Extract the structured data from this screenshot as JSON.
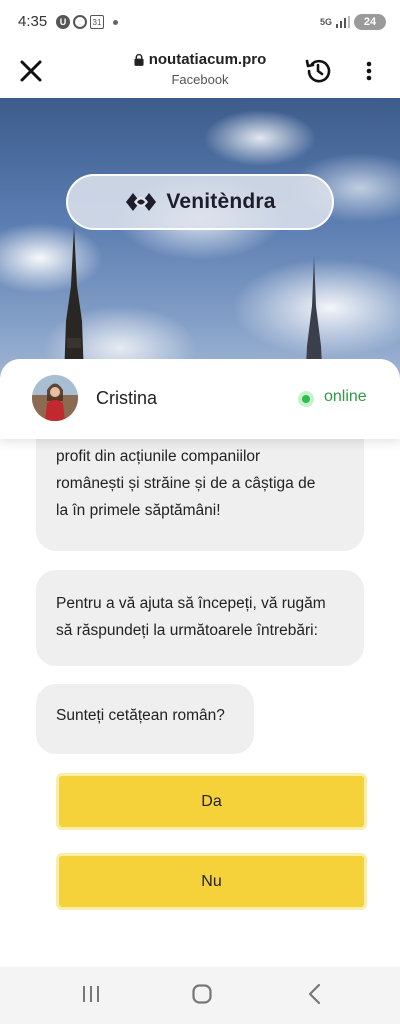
{
  "status_bar": {
    "time": "4:35",
    "badge_u": "U",
    "calendar_day": "31",
    "network": "5G",
    "battery": "24"
  },
  "browser": {
    "domain": "noutatiacum.pro",
    "subtitle": "Facebook",
    "icons": [
      "close-icon",
      "lock-icon",
      "history-icon",
      "more-vertical-icon"
    ]
  },
  "hero": {
    "brand_name": "Venitèndra",
    "icons": [
      "brand-logo-icon"
    ]
  },
  "chat": {
    "agent_name": "Cristina",
    "status": "online",
    "status_color": "#2bbf4a",
    "messages": [
      {
        "text_lines": [
          "profit din acțiunile companiilor",
          "românești și străine și de a câștiga de",
          "la în primele săptămâni!"
        ]
      },
      {
        "text_lines": [
          "Pentru a vă ajuta să începeți, vă rugăm",
          "să răspundeți la următoarele întrebări:"
        ]
      },
      {
        "text_lines": [
          "Sunteți cetățean român?"
        ]
      }
    ],
    "answers": {
      "yes": "Da",
      "no": "Nu"
    },
    "button_color": "#f5d23a"
  },
  "nav": {
    "icons": [
      "recent-apps-icon",
      "home-icon",
      "back-icon"
    ]
  }
}
